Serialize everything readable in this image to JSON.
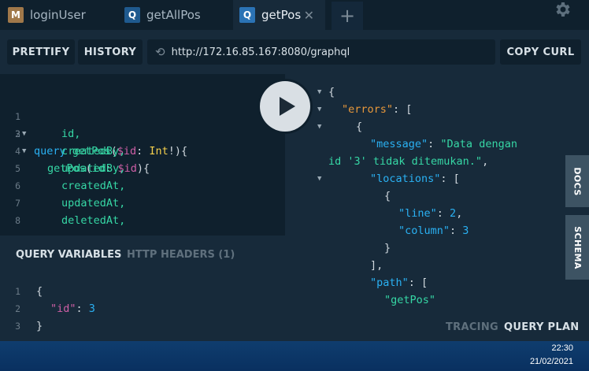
{
  "tabs": [
    {
      "badge": "M",
      "label": "loginUser",
      "badge_color": "#a0784a"
    },
    {
      "badge": "Q",
      "label": "getAllPos",
      "badge_color": "#1f5a8f"
    },
    {
      "badge": "Q",
      "label": "getPos",
      "badge_color": "#2b73b5"
    }
  ],
  "tab_close": "✕",
  "tab_add": "+",
  "toolbar": {
    "prettify": "PRETTIFY",
    "history": "HISTORY",
    "url": "http://172.16.85.167:8080/graphql",
    "copy_curl": "COPY CURL"
  },
  "query_lines": [
    {
      "n": "1",
      "fold": true
    },
    {
      "n": "2",
      "fold": true
    },
    {
      "n": "3",
      "text": "id,"
    },
    {
      "n": "4",
      "text": "createdBy,"
    },
    {
      "n": "5",
      "text": "updatedBy,"
    },
    {
      "n": "6",
      "text": "createdAt,"
    },
    {
      "n": "7",
      "text": "updatedAt,"
    },
    {
      "n": "8",
      "text": "deletedAt,"
    }
  ],
  "query": {
    "l1_kw": "query",
    "l1_name": "getPos",
    "l1_open": "(",
    "l1_var": "$id",
    "l1_colon": ": ",
    "l1_type": "Int",
    "l1_close": "!){",
    "l2_name": "getPos",
    "l2_open": "(",
    "l2_arg": "id",
    "l2_colon": ": ",
    "l2_var": "$id",
    "l2_close": "){"
  },
  "variables_panel": {
    "tab_variables": "QUERY VARIABLES",
    "tab_headers": "HTTP HEADERS (1)"
  },
  "variables": {
    "lines": [
      "1",
      "2",
      "3"
    ],
    "open": "{",
    "key": "\"id\"",
    "colon": ": ",
    "value": "3",
    "close": "}"
  },
  "result": {
    "open": "{",
    "errors_key": "\"errors\"",
    "errors_open": ": [",
    "obj_open": "{",
    "message_key": "\"message\"",
    "message_val_1": "\"Data dengan",
    "message_val_2": "id '3' tidak ditemukan.\"",
    "comma": ",",
    "locations_key": "\"locations\"",
    "locations_open": ": [",
    "loc_obj_open": "{",
    "line_key": "\"line\"",
    "line_val": "2",
    "column_key": "\"column\"",
    "column_val": "3",
    "loc_obj_close": "}",
    "locations_close": "],",
    "path_key": "\"path\"",
    "path_open": ": [",
    "path_val": "\"getPos\""
  },
  "side_tabs": {
    "docs": "DOCS",
    "schema": "SCHEMA"
  },
  "bottom": {
    "tracing": "TRACING",
    "query_plan": "QUERY PLAN"
  },
  "taskbar": {
    "time": "22:30",
    "date": "21/02/2021"
  }
}
